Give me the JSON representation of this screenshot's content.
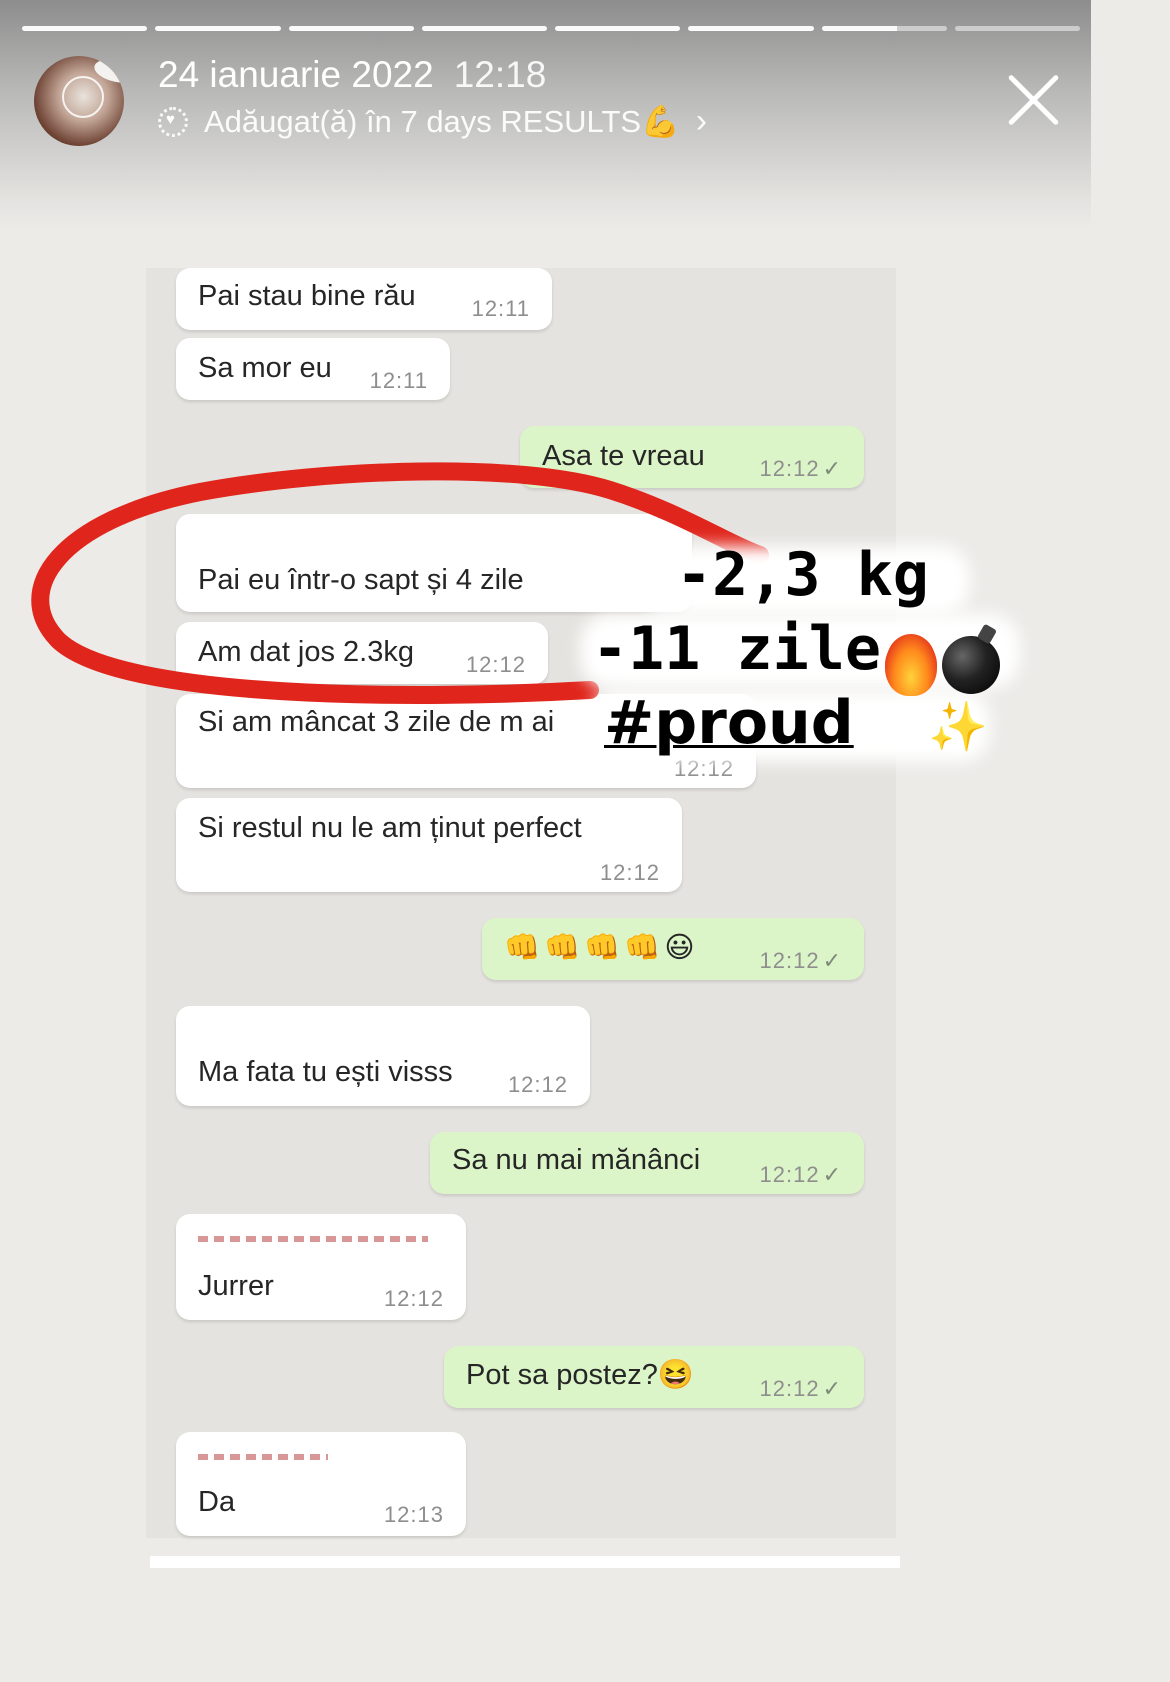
{
  "story": {
    "date": "24 ianuarie 2022",
    "time": "12:18",
    "added_to": "Adăugat(ă) în 7 days RESULTS💪",
    "arrow": "›",
    "progress_segments_total": 8,
    "progress_segments_seen": 6
  },
  "chat": {
    "messages": [
      {
        "dir": "in",
        "text": "Pai stau  bine rău",
        "time": "12:11"
      },
      {
        "dir": "in",
        "text": "Sa mor eu",
        "time": "12:11"
      },
      {
        "dir": "out",
        "text": "Asa te vreau",
        "time": "12:12",
        "check": "✓"
      },
      {
        "dir": "in",
        "text": "Pai eu într-o sapt și 4 zile",
        "time": ""
      },
      {
        "dir": "in",
        "text": "Am dat jos 2.3kg",
        "time": "12:12"
      },
      {
        "dir": "in",
        "text": "Si am mâncat 3 zile de m ai",
        "time": "12:12"
      },
      {
        "dir": "in",
        "text": "Si restul nu le am ținut perfect",
        "time": "12:12"
      },
      {
        "dir": "out",
        "text": "👊👊👊👊😃",
        "time": "12:12",
        "check": "✓"
      },
      {
        "dir": "in",
        "text": "Ma fata tu ești visss",
        "time": "12:12"
      },
      {
        "dir": "out",
        "text": "Sa nu mai mănânci",
        "time": "12:12",
        "check": "✓"
      },
      {
        "dir": "in",
        "text": "Jurrer",
        "time": "12:12"
      },
      {
        "dir": "out",
        "text": "Pot sa postez?😆",
        "time": "12:12",
        "check": "✓"
      },
      {
        "dir": "in",
        "text": "Da",
        "time": "12:13"
      }
    ]
  },
  "overlay": {
    "line1": "-2,3 kg",
    "line2": "-11 zile",
    "line3": "#proud",
    "accent": "#e0261c",
    "sparkles": "✨"
  }
}
